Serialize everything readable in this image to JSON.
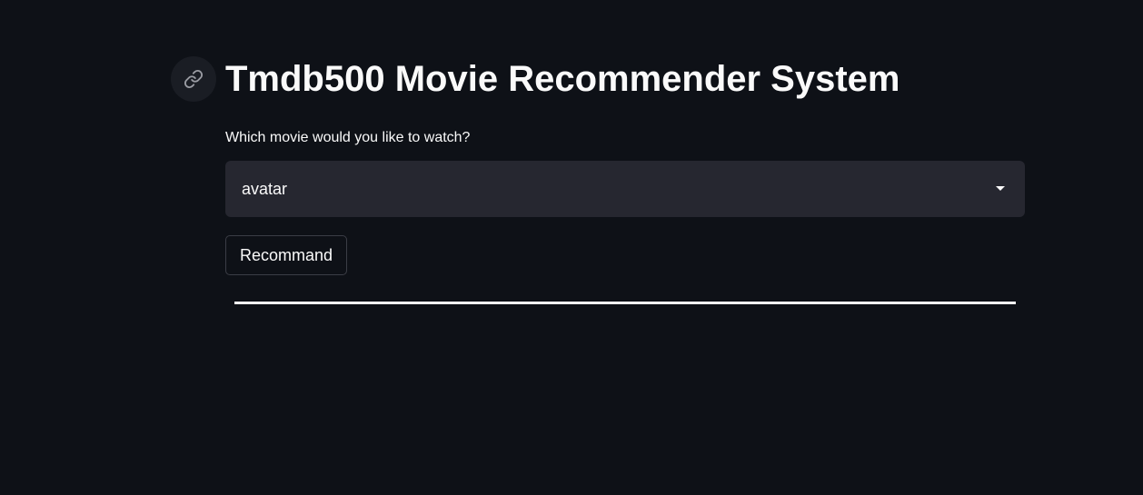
{
  "header": {
    "anchor_icon": "link-icon",
    "title": "Tmdb500 Movie Recommender System"
  },
  "form": {
    "select_label": "Which movie would you like to watch?",
    "selected_movie": "avatar",
    "select_icon": "caret-down-icon",
    "button_label": "Recommand"
  },
  "colors": {
    "background": "#0e1117",
    "select_background": "#262730",
    "text": "#fafafa",
    "button_border": "#3b3d46",
    "divider": "#ffffff"
  }
}
